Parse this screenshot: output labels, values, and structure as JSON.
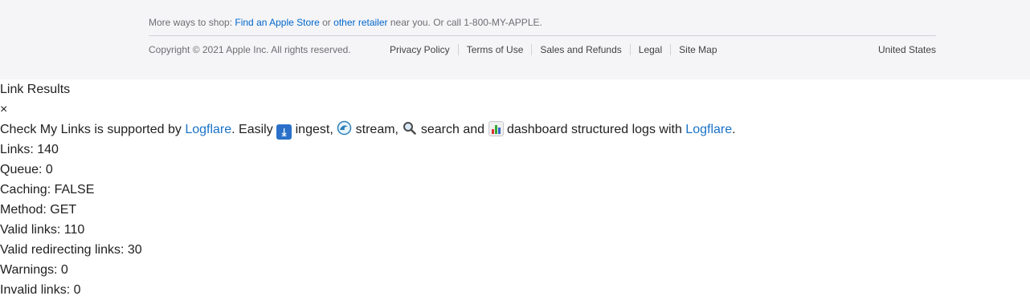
{
  "footer": {
    "shop_prefix": "More ways to shop: ",
    "find_store": "Find an Apple Store",
    "or_text": " or ",
    "other_retailer": "other retailer",
    "shop_suffix": " near you. Or call 1-800-MY-APPLE.",
    "copyright": "Copyright © 2021 Apple Inc. All rights reserved.",
    "links": [
      "Privacy Policy",
      "Terms of Use",
      "Sales and Refunds",
      "Legal",
      "Site Map"
    ],
    "locale": "United States"
  },
  "results": {
    "title": "Link Results",
    "close_symbol": "×",
    "support_prefix": "Check My Links is supported by ",
    "logflare": "Logflare",
    "easily": ". Easily ",
    "ingest": " ingest, ",
    "stream": " stream, ",
    "search": " search and ",
    "dashboard": " dashboard structured logs with ",
    "logflare2": "Logflare",
    "period": ".",
    "icons": {
      "ingest": "ingest-arrow-icon",
      "stream": "wave-icon",
      "search": "magnifier-icon",
      "dashboard": "bar-chart-icon"
    },
    "stats": [
      "Links: 140",
      "Queue: 0",
      "Caching: FALSE",
      "Method: GET",
      "Valid links: 110",
      "Valid redirecting links: 30",
      "Warnings: 0",
      "Invalid links: 0"
    ]
  }
}
